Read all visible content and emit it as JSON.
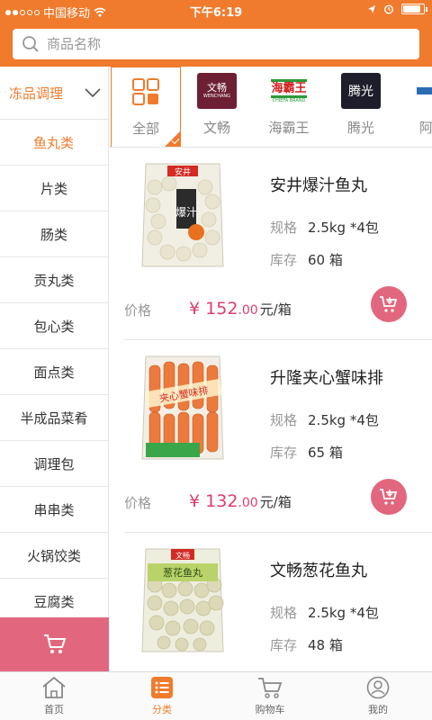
{
  "status_bar": {
    "carrier": "中国移动",
    "time": "下午6:19"
  },
  "search": {
    "placeholder": "商品名称"
  },
  "sidebar": {
    "category_select": "冻品调理",
    "items": [
      {
        "label": "鱼丸类",
        "active": true
      },
      {
        "label": "片类"
      },
      {
        "label": "肠类"
      },
      {
        "label": "贡丸类"
      },
      {
        "label": "包心类"
      },
      {
        "label": "面点类"
      },
      {
        "label": "半成品菜肴"
      },
      {
        "label": "调理包"
      },
      {
        "label": "串串类"
      },
      {
        "label": "火锅饺类"
      },
      {
        "label": "豆腐类"
      }
    ]
  },
  "brands": [
    {
      "name": "全部",
      "selected": true
    },
    {
      "name": "文畅",
      "logo_text": "文畅",
      "logo_sub": "WENCHANG"
    },
    {
      "name": "海霸王",
      "logo_text": "海霸王",
      "logo_sub": "CHIEFA BRAND"
    },
    {
      "name": "腾光",
      "logo_text": "腾光"
    },
    {
      "name": "阿拍"
    }
  ],
  "products": [
    {
      "name": "安井爆汁鱼丸",
      "spec_label": "规格",
      "spec": "2.5kg *4包",
      "stock_label": "库存",
      "stock": "60 箱",
      "price_label": "价格",
      "currency": "¥",
      "price_int": "152",
      "price_dec": ".00",
      "unit": "元/箱",
      "pack_label": "安井",
      "pack_text": "爆汁"
    },
    {
      "name": "升隆夹心蟹味排",
      "spec_label": "规格",
      "spec": "2.5kg *4包",
      "stock_label": "库存",
      "stock": "65 箱",
      "price_label": "价格",
      "currency": "¥",
      "price_int": "132",
      "price_dec": ".00",
      "unit": "元/箱",
      "pack_text": "夹心蟹味排"
    },
    {
      "name": "文畅葱花鱼丸",
      "spec_label": "规格",
      "spec": "2.5kg *4包",
      "stock_label": "库存",
      "stock": "48 箱",
      "pack_label": "文畅",
      "pack_text": "葱花鱼丸"
    }
  ],
  "tabbar": [
    {
      "label": "首页"
    },
    {
      "label": "分类",
      "active": true
    },
    {
      "label": "购物车"
    },
    {
      "label": "我的"
    }
  ],
  "colors": {
    "accent": "#f07b2d",
    "price": "#e03c6e",
    "cart": "#e2677e"
  }
}
